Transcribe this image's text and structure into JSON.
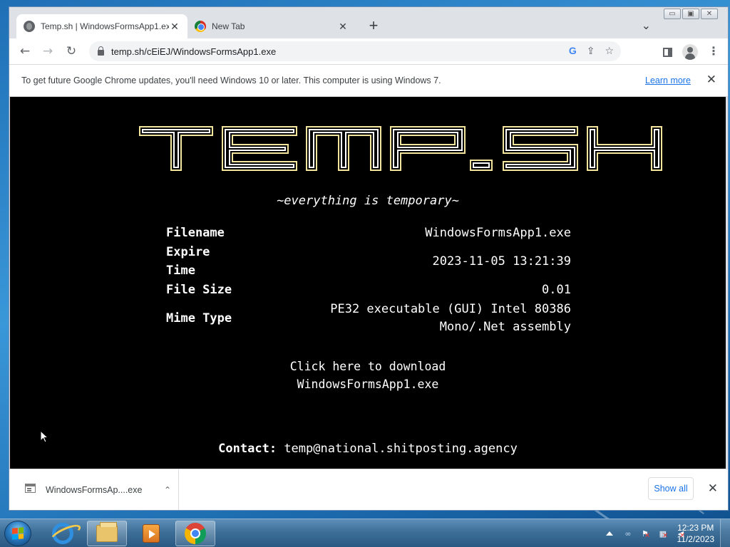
{
  "browser": {
    "tabs": [
      {
        "title": "Temp.sh | WindowsFormsApp1.exe",
        "close": "✕"
      },
      {
        "title": "New Tab",
        "close": "✕"
      }
    ],
    "new_tab": "+",
    "tab_search": "⌄",
    "window_controls": {
      "minimize": "▭",
      "maximize": "▣",
      "close": "✕"
    },
    "nav": {
      "back": "←",
      "forward": "→",
      "reload": "↻"
    },
    "url": "temp.sh/cEiEJ/WindowsFormsApp1.exe",
    "omnibox_icons": {
      "google": "G",
      "share": "⇪",
      "bookmark": "☆"
    },
    "menu": "⋮"
  },
  "infobar": {
    "message": "To get future Google Chrome updates, you'll need Windows 10 or later. This computer is using Windows 7.",
    "link": "Learn more",
    "close": "✕"
  },
  "page": {
    "logo_text": "TEMP.SH",
    "tagline": "~everything is temporary~",
    "fields": {
      "filename_label": "Filename",
      "filename_value": "WindowsFormsApp1.exe",
      "expire_label": "Expire Time",
      "expire_value": "2023-11-05 13:21:39",
      "size_label": "File Size",
      "size_value": "0.01",
      "mime_label": "Mime Type",
      "mime_value_line1": "PE32 executable (GUI) Intel 80386",
      "mime_value_line2": "Mono/.Net assembly"
    },
    "download_line1": "Click here to download",
    "download_line2": "WindowsFormsApp1.exe",
    "contact_label": "Contact:",
    "contact_email": "temp@national.shitposting.agency"
  },
  "download_shelf": {
    "item_name": "WindowsFormsAp....exe",
    "chevron": "⌃",
    "show_all": "Show all",
    "close": "✕"
  },
  "taskbar": {
    "clock_time": "12:23 PM",
    "clock_date": "11/2/2023",
    "apps": [
      "internet-explorer",
      "windows-explorer",
      "media-player",
      "google-chrome"
    ]
  },
  "colors": {
    "page_background": "#000000",
    "link": "#1a73e8",
    "taskbar": "#3e6f98"
  }
}
